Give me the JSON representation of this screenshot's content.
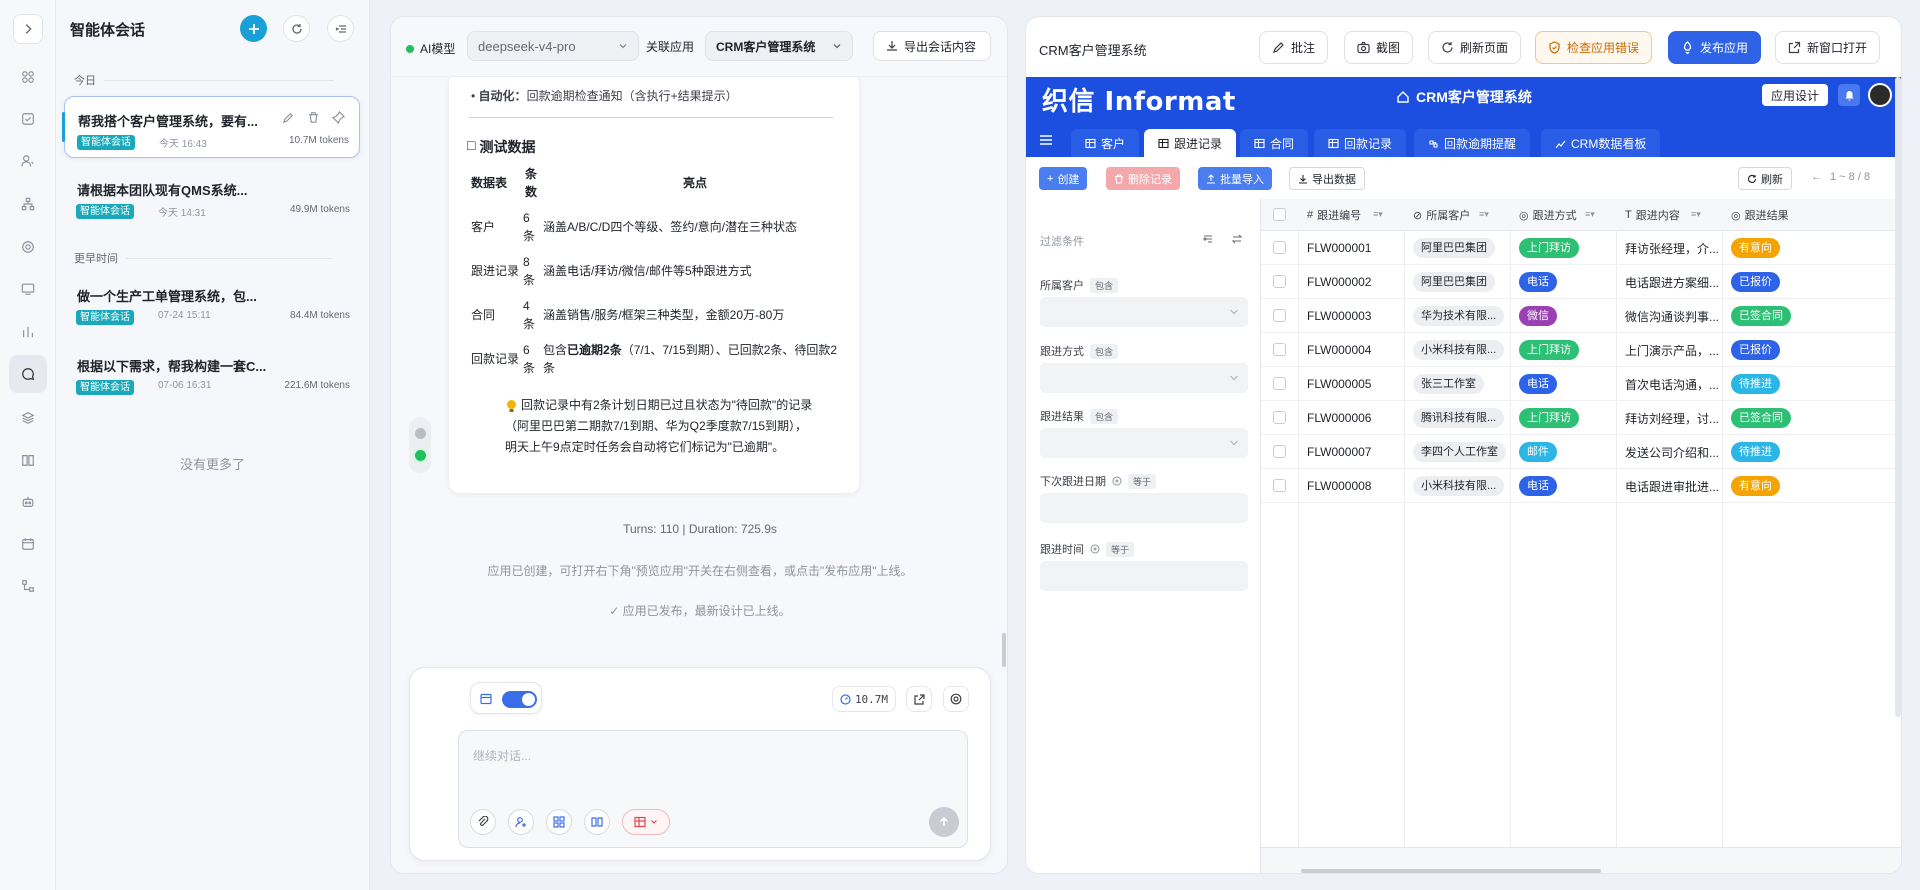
{
  "colors": {
    "accent": "#1c4fe0",
    "brand_teal": "#1aa9ba",
    "online": "#20c05c"
  },
  "rail": {
    "icons": [
      "expand-icon",
      "apps-icon",
      "tasks-icon",
      "users-icon",
      "org-icon",
      "settings-icon",
      "monitor-icon",
      "stats-icon",
      "chat-icon",
      "layers-icon",
      "book-icon",
      "robot-icon",
      "calendar-icon",
      "flow-icon"
    ],
    "active": "chat-icon"
  },
  "sessions": {
    "title": "智能体会话",
    "groups": {
      "today": "今日",
      "earlier": "更早时间"
    },
    "items": [
      {
        "title": "帮我搭个客户管理系统，要有...",
        "tag": "智能体会话",
        "time": "今天 16:43",
        "tokens": "10.7M tokens"
      },
      {
        "title": "请根据本团队现有QMS系统...",
        "tag": "智能体会话",
        "time": "今天 14:31",
        "tokens": "49.9M tokens"
      },
      {
        "title": "做一个生产工单管理系统，包...",
        "tag": "智能体会话",
        "time": "07-24 15:11",
        "tokens": "84.4M tokens"
      },
      {
        "title": "根据以下需求，帮我构建一套C...",
        "tag": "智能体会话",
        "time": "07-06 16:31",
        "tokens": "221.6M tokens"
      }
    ],
    "no_more": "没有更多了"
  },
  "chat": {
    "model_label": "AI模型",
    "model_value": "deepseek-v4-pro",
    "related_label": "关联应用",
    "related_value": "CRM客户管理系统",
    "export_label": "导出会话内容",
    "auto_prefix": "自动化：",
    "auto_text": "回款逾期检查通知（含执行+结果提示）",
    "section_title": "测试数据",
    "section_icon": "□",
    "table_headers": [
      "数据表",
      "条数",
      "亮点"
    ],
    "table_rows": [
      {
        "name": "客户",
        "count": "6条",
        "desc": "涵盖A/B/C/D四个等级、签约/意向/潜在三种状态"
      },
      {
        "name": "跟进记录",
        "count": "8条",
        "desc": "涵盖电话/拜访/微信/邮件等5种跟进方式"
      },
      {
        "name": "合同",
        "count": "4条",
        "desc": "涵盖销售/服务/框架三种类型，金额20万-80万"
      },
      {
        "name": "回款记录",
        "count": "6条",
        "desc_a": "包含",
        "desc_b": "已逾期2条",
        "desc_c": "（7/1、7/15到期）、已回款2条、待回款2条"
      }
    ],
    "note": "回款记录中有2条计划日期已过且状态为\"待回款\"的记录（阿里巴巴第二期款7/1到期、华为Q2季度款7/15到期），明天上午9点定时任务会自动将它们标记为\"已逾期\"。",
    "turns": "Turns: 110 | Duration: 725.9s",
    "system_msg": "应用已创建，可打开右下角\"预览应用\"开关在右侧查看，或点击\"发布应用\"上线。",
    "published_msg": "✓ 应用已发布，最新设计已上线。",
    "token_badge": "10.7M",
    "input_placeholder": "继续对话..."
  },
  "preview": {
    "title": "CRM客户管理系统",
    "toolbar": [
      "批注",
      "截图",
      "刷新页面",
      "检查应用错误",
      "发布应用",
      "新窗口打开"
    ],
    "logo": "织信 Informat",
    "app_title": "CRM客户管理系统",
    "app_design": "应用设计",
    "tabs": [
      "客户",
      "跟进记录",
      "合同",
      "回款记录",
      "回款逾期提醒",
      "CRM数据看板"
    ],
    "active_tab": "跟进记录",
    "actions": {
      "create": "创建",
      "delete": "删除记录",
      "import": "批量导入",
      "export": "导出数据",
      "refresh": "刷新",
      "pager": "1 ~ 8 / 8"
    },
    "filter": {
      "title": "过滤条件",
      "fields": [
        {
          "label": "所属客户",
          "op": "包含"
        },
        {
          "label": "跟进方式",
          "op": "包含"
        },
        {
          "label": "跟进结果",
          "op": "包含"
        },
        {
          "label": "下次跟进日期",
          "op": "等于"
        },
        {
          "label": "跟进时间",
          "op": "等于"
        }
      ]
    },
    "columns": [
      "跟进编号",
      "所属客户",
      "跟进方式",
      "跟进内容",
      "跟进结果"
    ],
    "rows": [
      {
        "id": "FLW000001",
        "customer": "阿里巴巴集团",
        "method": "上门拜访",
        "content": "拜访张经理，介...",
        "result": "有意向"
      },
      {
        "id": "FLW000002",
        "customer": "阿里巴巴集团",
        "method": "电话",
        "content": "电话跟进方案细...",
        "result": "已报价"
      },
      {
        "id": "FLW000003",
        "customer": "华为技术有限...",
        "method": "微信",
        "content": "微信沟通谈判事...",
        "result": "已签合同"
      },
      {
        "id": "FLW000004",
        "customer": "小米科技有限...",
        "method": "上门拜访",
        "content": "上门演示产品，...",
        "result": "已报价"
      },
      {
        "id": "FLW000005",
        "customer": "张三工作室",
        "method": "电话",
        "content": "首次电话沟通，...",
        "result": "待推进"
      },
      {
        "id": "FLW000006",
        "customer": "腾讯科技有限...",
        "method": "上门拜访",
        "content": "拜访刘经理，讨...",
        "result": "已签合同"
      },
      {
        "id": "FLW000007",
        "customer": "李四个人工作室",
        "method": "邮件",
        "content": "发送公司介绍和...",
        "result": "待推进"
      },
      {
        "id": "FLW000008",
        "customer": "小米科技有限...",
        "method": "电话",
        "content": "电话跟进审批进...",
        "result": "有意向"
      }
    ]
  }
}
